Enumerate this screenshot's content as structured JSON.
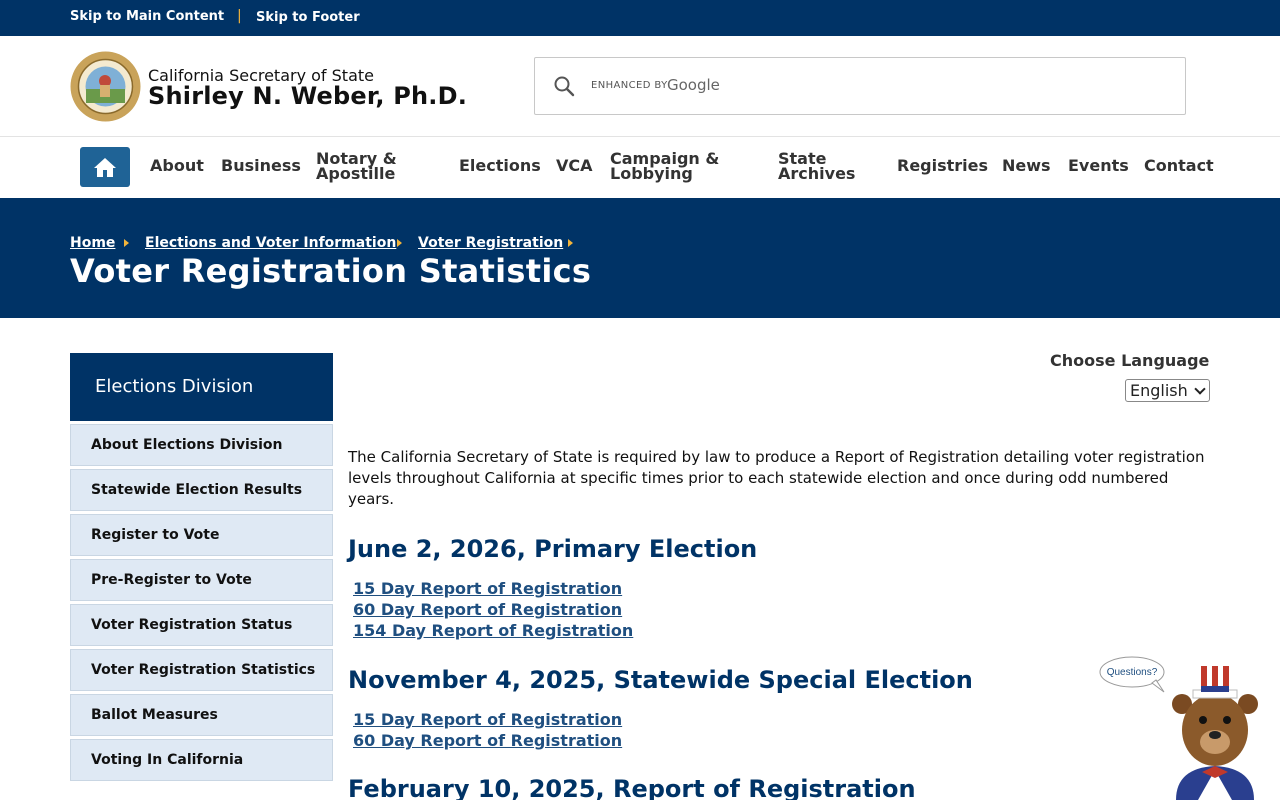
{
  "skip_links": {
    "main": "Skip to Main Content",
    "separator": "|",
    "footer": "Skip to Footer"
  },
  "header": {
    "org": "California Secretary of State",
    "name": "Shirley N. Weber, Ph.D.",
    "search": {
      "enhanced_by": "ENHANCED BY",
      "provider": "Google"
    }
  },
  "nav": {
    "items": [
      {
        "label": "About"
      },
      {
        "label": "Business"
      },
      {
        "label": "Notary & Apostille",
        "line1": "Notary &",
        "line2": "Apostille"
      },
      {
        "label": "Elections"
      },
      {
        "label": "VCA"
      },
      {
        "label": "Campaign & Lobbying",
        "line1": "Campaign &",
        "line2": "Lobbying"
      },
      {
        "label": "State Archives",
        "line1": "State",
        "line2": "Archives"
      },
      {
        "label": "Registries"
      },
      {
        "label": "News"
      },
      {
        "label": "Events"
      },
      {
        "label": "Contact"
      }
    ]
  },
  "breadcrumb": [
    "Home",
    "Elections and Voter Information",
    "Voter Registration"
  ],
  "page_title": "Voter Registration Statistics",
  "sidebar": {
    "heading": "Elections Division",
    "items": [
      "About Elections Division",
      "Statewide Election Results",
      "Register to Vote",
      "Pre-Register to Vote",
      "Voter Registration Status",
      "Voter Registration Statistics",
      "Ballot Measures",
      "Voting In California"
    ]
  },
  "language": {
    "label": "Choose Language",
    "selected": "English"
  },
  "content": {
    "intro": "The California Secretary of State is required by law to produce a Report of Registration detailing voter registration levels throughout California at specific times prior to each statewide election and once during odd numbered years.",
    "sections": [
      {
        "heading": "June 2, 2026, Primary Election",
        "reports": [
          "15 Day Report of Registration",
          "60 Day Report of Registration",
          "154 Day Report of Registration"
        ]
      },
      {
        "heading": "November 4, 2025, Statewide Special Election",
        "reports": [
          "15 Day Report of Registration",
          "60 Day Report of Registration"
        ]
      },
      {
        "heading": "February 10, 2025, Report of Registration",
        "reports": []
      }
    ]
  },
  "chat_widget": {
    "bubble": "Questions?"
  },
  "colors": {
    "navy": "#003366",
    "accent_gold": "#f2b43b",
    "home_blue": "#1f6396",
    "sidebar_bg": "#dfe9f4",
    "link_blue": "#1f4f80"
  }
}
